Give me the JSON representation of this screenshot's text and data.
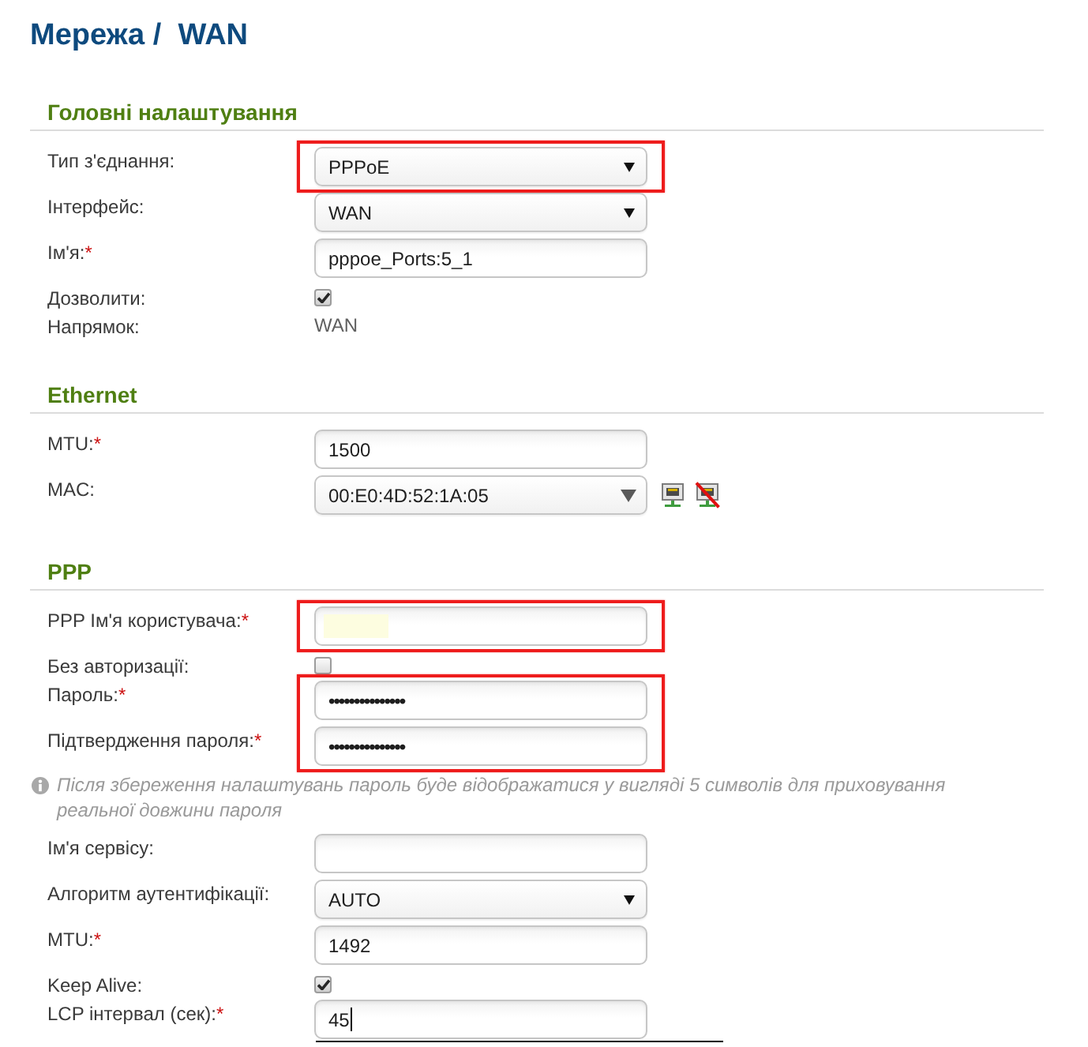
{
  "page_title": "Мережа /  WAN",
  "sections": [
    {
      "title": "Головні налаштування",
      "rows": [
        {
          "kind": "select",
          "label": "Тип з'єднання:",
          "value": "PPPoE",
          "highlighted": true
        },
        {
          "kind": "select",
          "label": "Інтерфейс:",
          "value": "WAN",
          "highlighted": false
        },
        {
          "kind": "text_input",
          "label": "Ім'я:",
          "required_mark": "*",
          "value": "pppoe_Ports:5_1",
          "value_redacted": false,
          "focused": false,
          "highlighted": false
        },
        {
          "kind": "checkbox",
          "label": "Дозволити:",
          "checked": true,
          "highlighted": false
        },
        {
          "kind": "static",
          "label": "Напрямок:",
          "value": "WAN",
          "highlighted": false
        }
      ]
    },
    {
      "title": "Ethernet",
      "rows": [
        {
          "kind": "text_input",
          "label": "MTU:",
          "required_mark": "*",
          "value": "1500",
          "value_redacted": false,
          "focused": false,
          "highlighted": false
        },
        {
          "kind": "combobox",
          "label": "MAC:",
          "value": "00:E0:4D:52:1A:05",
          "highlighted": false
        }
      ]
    },
    {
      "title": "PPP",
      "rows": [
        {
          "kind": "text_input",
          "label": "PPP Ім'я користувача:",
          "required_mark": "*",
          "value_redacted": true,
          "focused": false,
          "highlighted": true
        },
        {
          "kind": "checkbox",
          "label": "Без авторизації:",
          "checked": false,
          "highlighted": false
        },
        {
          "kind": "password",
          "label": "Пароль:",
          "required_mark": "*",
          "value": "•••••••••••••••",
          "highlighted": true
        },
        {
          "kind": "password",
          "label": "Підтвердження пароля:",
          "required_mark": "*",
          "value": "•••••••••••••••",
          "highlighted": true
        },
        {
          "kind": "note",
          "text": "Після збереження налаштувань пароль буде відображатися у вигляді 5 символів для приховування реальної довжини пароля"
        },
        {
          "kind": "text_input",
          "label": "Ім'я сервісу:",
          "value_redacted": false,
          "focused": false,
          "highlighted": false
        },
        {
          "kind": "select",
          "label": "Алгоритм аутентифікації:",
          "value": "AUTO",
          "highlighted": false
        },
        {
          "kind": "text_input",
          "label": "MTU:",
          "required_mark": "*",
          "value": "1492",
          "value_redacted": false,
          "focused": false,
          "highlighted": false
        },
        {
          "kind": "checkbox",
          "label": "Keep Alive:",
          "checked": true,
          "highlighted": false
        },
        {
          "kind": "text_input",
          "label": "LCP інтервал (сек):",
          "required_mark": "*",
          "value": "45",
          "value_redacted": false,
          "focused": true,
          "highlighted": false
        }
      ]
    }
  ]
}
